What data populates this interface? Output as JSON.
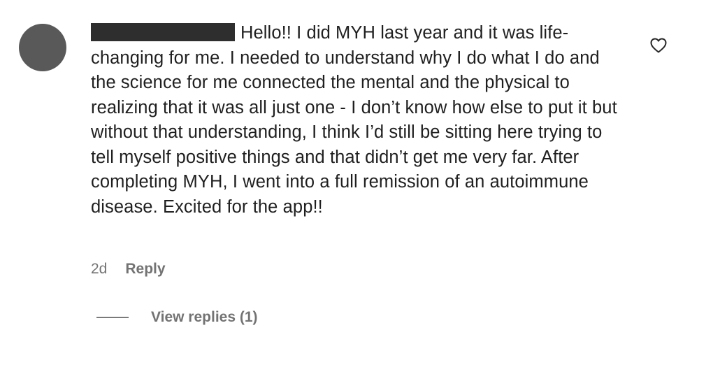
{
  "comment": {
    "author_redacted": true,
    "text": "Hello!! I did MYH last year and it was life-changing for me. I needed to understand why I do what I do and the science for me connected the mental and the physical to realizing that it was all just one - I don’t know how else to put it but without that understanding, I think I’d still be sitting here trying to tell myself positive things and that didn’t get me very far. After completing MYH, I went into a full remission of an autoimmune disease. Excited for the app!!",
    "timestamp": "2d",
    "reply_label": "Reply",
    "view_replies_label": "View replies (1)",
    "like_icon": "heart-outline-icon"
  },
  "colors": {
    "avatar": "#595959",
    "redaction": "#2e2e2e",
    "text": "#1f1f1f",
    "secondary_text": "#737373"
  }
}
